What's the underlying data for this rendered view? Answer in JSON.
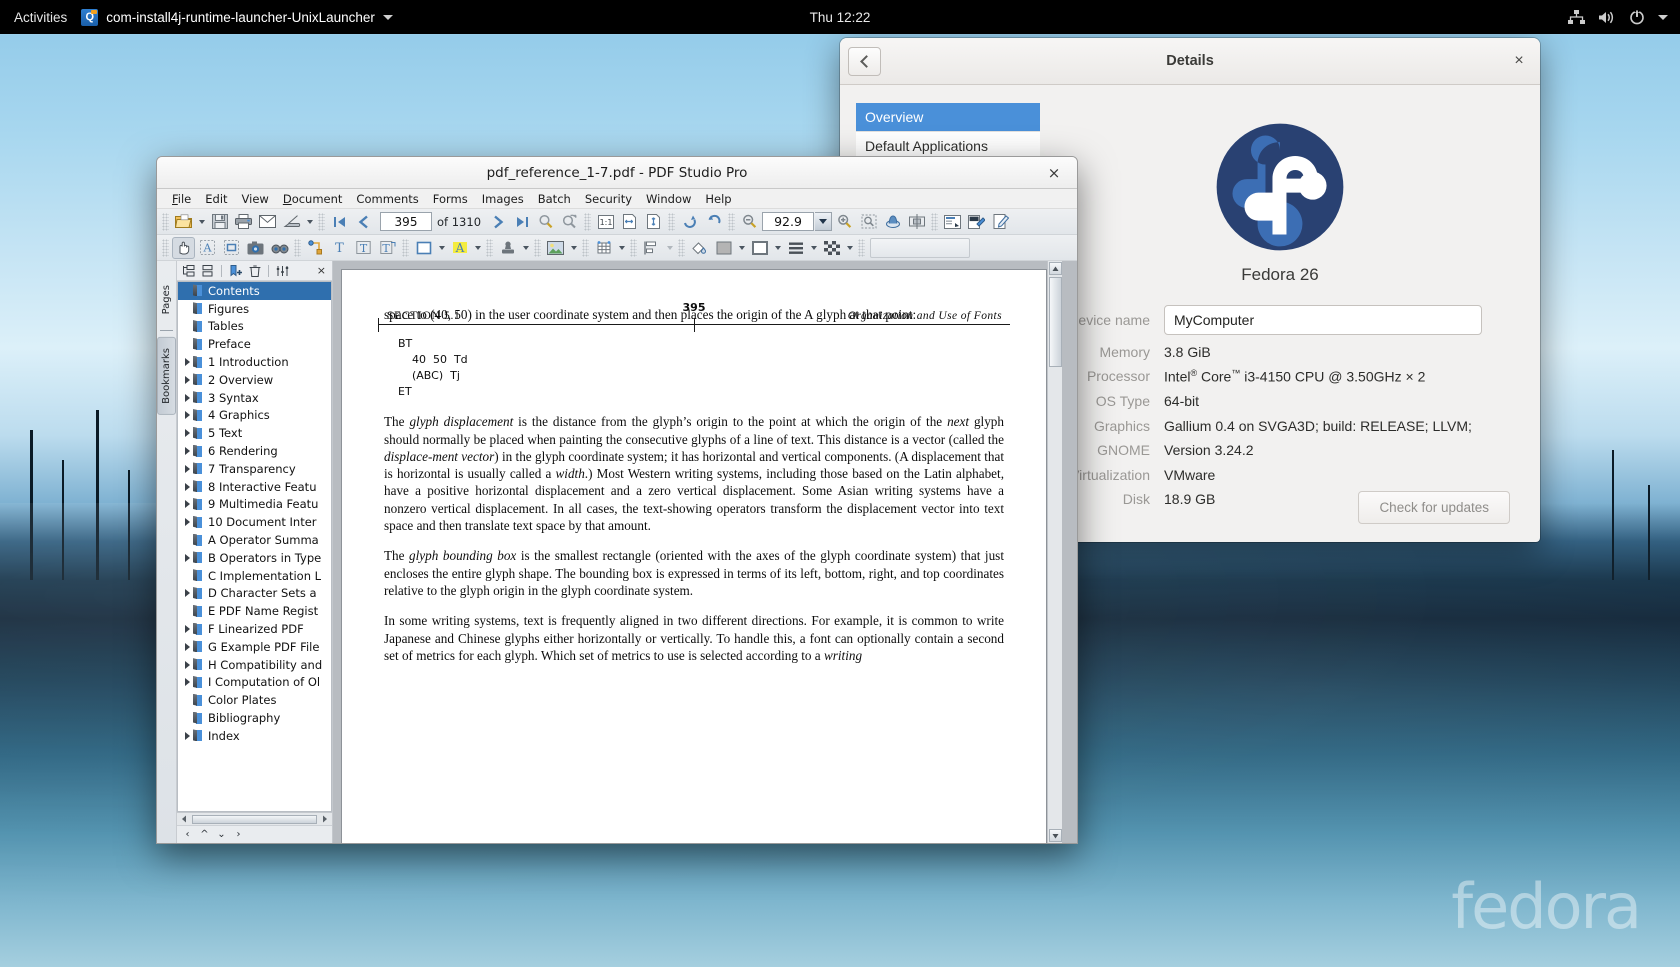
{
  "topbar": {
    "activities": "Activities",
    "app_name": "com-install4j-runtime-launcher-UnixLauncher",
    "clock": "Thu 12:22",
    "icons": [
      "network-icon",
      "volume-icon",
      "power-icon",
      "chevron-down-icon"
    ]
  },
  "desktop": {
    "watermark": "fedora"
  },
  "details_window": {
    "title": "Details",
    "back_label": "‹",
    "close_label": "×",
    "sidebar": [
      {
        "label": "Overview",
        "selected": true
      },
      {
        "label": "Default Applications",
        "selected": false
      }
    ],
    "os_name": "Fedora 26",
    "specs": [
      {
        "label": "Device name",
        "value": "MyComputer",
        "is_field": true
      },
      {
        "label": "Memory",
        "value": "3.8 GiB",
        "is_field": false
      },
      {
        "label": "Processor",
        "value": "Intel® Core™ i3-4150 CPU @ 3.50GHz × 2",
        "is_field": false
      },
      {
        "label": "OS Type",
        "value": "64-bit",
        "is_field": false
      },
      {
        "label": "Graphics",
        "value": "Gallium 0.4 on SVGA3D; build: RELEASE; LLVM;",
        "is_field": false
      },
      {
        "label": "GNOME",
        "value": "Version 3.24.2",
        "is_field": false
      },
      {
        "label": "Virtualization",
        "value": "VMware",
        "is_field": false
      },
      {
        "label": "Disk",
        "value": "18.9 GB",
        "is_field": false
      }
    ],
    "check_updates_label": "Check for updates"
  },
  "pdf_window": {
    "title": "pdf_reference_1-7.pdf - PDF Studio Pro",
    "close_label": "×",
    "menus": [
      "File",
      "Edit",
      "View",
      "Document",
      "Comments",
      "Forms",
      "Images",
      "Batch",
      "Security",
      "Window",
      "Help"
    ],
    "toolbar1_icons": [
      "open-folder-icon",
      "save-icon",
      "print-icon",
      "email-icon",
      "scan-icon",
      "first-page-icon",
      "previous-page-icon",
      "next-page-icon",
      "last-page-icon",
      "search-icon",
      "redo-search-icon",
      "actual-size-icon",
      "fit-width-icon",
      "fit-page-icon",
      "rotate-clockwise-icon",
      "rotate-counterclockwise-icon",
      "zoom-out-icon",
      "zoom-in-icon",
      "marquee-zoom-icon",
      "loupe-icon",
      "split-view-icon",
      "properties-icon",
      "ocr-icon",
      "edit-icon"
    ],
    "toolbar2_icons": [
      "hand-tool-icon",
      "text-select-icon",
      "area-select-icon",
      "snapshot-icon",
      "reading-glasses-icon",
      "measure-icon",
      "text-box-icon",
      "text-callout-icon",
      "typewriter-icon",
      "rectangle-icon",
      "highlight-icon",
      "stamp-icon",
      "image-icon",
      "table-icon",
      "align-icon",
      "fill-color-icon",
      "color-swatch-icon",
      "border-color-icon",
      "line-weight-icon",
      "pattern-icon"
    ],
    "page_current": "395",
    "page_total_label": "of 1310",
    "zoom_value": "92.9",
    "vertical_tabs": [
      {
        "label": "Pages",
        "selected": false
      },
      {
        "label": "Bookmarks",
        "selected": true
      }
    ],
    "tree_toolbar_icons": [
      "expand-all-icon",
      "collapse-all-icon",
      "add-bookmark-icon",
      "delete-bookmark-icon",
      "bookmark-properties-icon"
    ],
    "tree_close_label": "×",
    "bookmarks": [
      {
        "label": "Contents",
        "expandable": false,
        "selected": true
      },
      {
        "label": "Figures",
        "expandable": false,
        "selected": false
      },
      {
        "label": "Tables",
        "expandable": false,
        "selected": false
      },
      {
        "label": "Preface",
        "expandable": false,
        "selected": false
      },
      {
        "label": "1 Introduction",
        "expandable": true,
        "selected": false
      },
      {
        "label": "2 Overview",
        "expandable": true,
        "selected": false
      },
      {
        "label": "3 Syntax",
        "expandable": true,
        "selected": false
      },
      {
        "label": "4 Graphics",
        "expandable": true,
        "selected": false
      },
      {
        "label": "5 Text",
        "expandable": true,
        "selected": false
      },
      {
        "label": "6 Rendering",
        "expandable": true,
        "selected": false
      },
      {
        "label": "7 Transparency",
        "expandable": true,
        "selected": false
      },
      {
        "label": "8 Interactive Featu",
        "expandable": true,
        "selected": false
      },
      {
        "label": "9 Multimedia Featu",
        "expandable": true,
        "selected": false
      },
      {
        "label": "10 Document Inter",
        "expandable": true,
        "selected": false
      },
      {
        "label": "A Operator Summa",
        "expandable": false,
        "selected": false
      },
      {
        "label": "B Operators in Type",
        "expandable": true,
        "selected": false
      },
      {
        "label": "C Implementation L",
        "expandable": false,
        "selected": false
      },
      {
        "label": "D Character Sets a",
        "expandable": true,
        "selected": false
      },
      {
        "label": "E PDF Name Regist",
        "expandable": false,
        "selected": false
      },
      {
        "label": "F Linearized PDF",
        "expandable": true,
        "selected": false
      },
      {
        "label": "G Example PDF File",
        "expandable": true,
        "selected": false
      },
      {
        "label": "H Compatibility and",
        "expandable": true,
        "selected": false
      },
      {
        "label": "I Computation of Ol",
        "expandable": true,
        "selected": false
      },
      {
        "label": "Color Plates",
        "expandable": false,
        "selected": false
      },
      {
        "label": "Bibliography",
        "expandable": false,
        "selected": false
      },
      {
        "label": "Index",
        "expandable": true,
        "selected": false
      }
    ]
  },
  "pdf_page": {
    "section": "SECTION 5.1",
    "page_number": "395",
    "running_head": "Organization and Use of Fonts",
    "para1": "space to (40, 50) in the user coordinate system and then places the origin of the A glyph at that point:",
    "code": "BT\n    40  50  Td\n    (ABC)  Tj\nET",
    "para2_lead": "The ",
    "para2_em1": "glyph displacement",
    "para2_a": " is the distance from the glyph’s origin to the point at which the origin of the ",
    "para2_em2": "next",
    "para2_b": " glyph should normally be placed when painting the consecutive glyphs of a line of text. This distance is a vector (called the ",
    "para2_em3": "displace-ment vector",
    "para2_c": ") in the glyph coordinate system; it has horizontal and vertical components. (A displacement that is horizontal is usually called a ",
    "para2_em4": "width",
    "para2_d": ".) Most Western writing systems, including those based on the Latin alphabet, have a positive horizontal displacement and a zero vertical displacement. Some Asian writing systems have a nonzero vertical displacement. In all cases, the text-showing operators transform the displacement vector into text space and then translate text space by that amount.",
    "para3_lead": "The ",
    "para3_em1": "glyph bounding box",
    "para3_a": " is the smallest rectangle (oriented with the axes of the glyph coordinate system) that just encloses the entire glyph shape. The bounding box is expressed in terms of its left, bottom, right, and top coordinates relative to the glyph origin in the glyph coordinate system.",
    "para4": "In some writing systems, text is frequently aligned in two different directions. For example, it is common to write Japanese and Chinese glyphs either horizontally or vertically. To handle this, a font can optionally contain a second set of metrics for each glyph. Which set of metrics to use is selected according to a ",
    "para4_em": "writing"
  },
  "colors": {
    "gnome_selection": "#4a90d9",
    "pdf_tree_selection": "#2f6fae",
    "fedora_blue": "#294172",
    "fedora_light_blue": "#3c6eb4"
  }
}
